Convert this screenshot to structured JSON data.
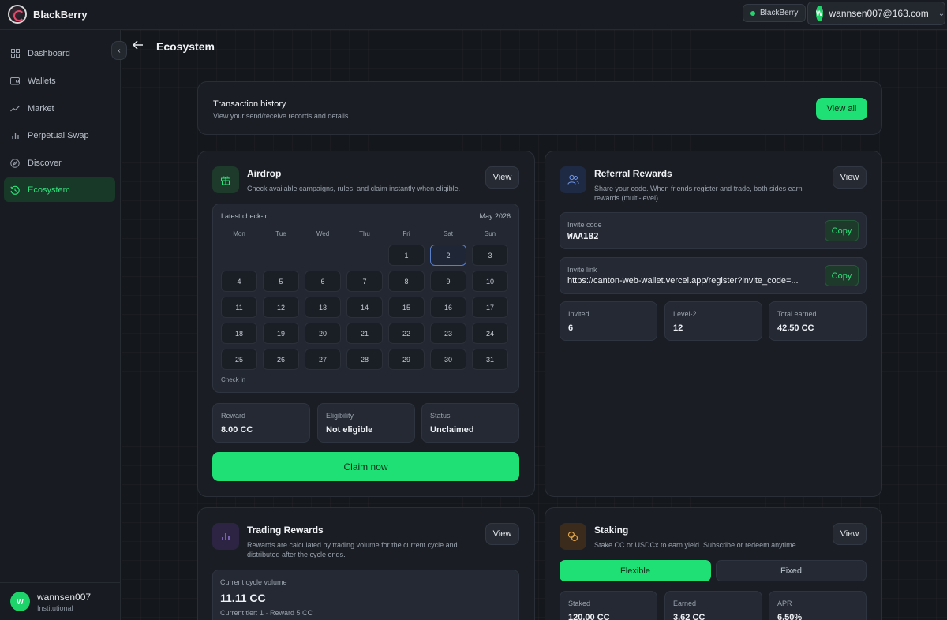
{
  "app": {
    "brand": "BlackBerry"
  },
  "header": {
    "network_label": "BlackBerry",
    "user_initial": "W",
    "user_email": "wannsen007@163.com"
  },
  "sidebar": {
    "items": [
      {
        "label": "Dashboard",
        "icon": "grid-icon"
      },
      {
        "label": "Wallets",
        "icon": "wallet-icon"
      },
      {
        "label": "Market",
        "icon": "trend-icon"
      },
      {
        "label": "Perpetual Swap",
        "icon": "bar-chart-icon"
      },
      {
        "label": "Discover",
        "icon": "compass-icon"
      },
      {
        "label": "Ecosystem",
        "icon": "history-icon",
        "active": true
      }
    ],
    "user": {
      "initial": "W",
      "name": "wannsen007",
      "role": "Institutional"
    }
  },
  "page": {
    "title": "Ecosystem"
  },
  "transactions": {
    "title": "Transaction history",
    "subtitle": "View your send/receive records and details",
    "button": "View all"
  },
  "airdrop": {
    "title": "Airdrop",
    "subtitle": "Check available campaigns, rules, and claim instantly when eligible.",
    "view_button": "View",
    "calendar": {
      "label": "Latest check-in",
      "month": "May 2026",
      "weekdays": [
        "Mon",
        "Tue",
        "Wed",
        "Thu",
        "Fri",
        "Sat",
        "Sun"
      ],
      "first_weekday_index": 4,
      "days_in_month": 31,
      "highlighted_day": 2,
      "footer": "Check in"
    },
    "reward": {
      "label": "Reward",
      "value": "8.00 CC"
    },
    "eligibility": {
      "label": "Eligibility",
      "value": "Not eligible"
    },
    "status": {
      "label": "Status",
      "value": "Unclaimed"
    },
    "claim_button": "Claim now"
  },
  "referral": {
    "title": "Referral Rewards",
    "subtitle": "Share your code. When friends register and trade, both sides earn rewards (multi-level).",
    "view_button": "View",
    "invite_code": {
      "label": "Invite code",
      "value": "WAA1B2",
      "button": "Copy"
    },
    "invite_link": {
      "label": "Invite link",
      "value": "https://canton-web-wallet.vercel.app/register?invite_code=...",
      "button": "Copy"
    },
    "invited": {
      "label": "Invited",
      "value": "6"
    },
    "level2": {
      "label": "Level-2",
      "value": "12"
    },
    "total_earned": {
      "label": "Total earned",
      "value": "42.50 CC"
    }
  },
  "trading": {
    "title": "Trading Rewards",
    "subtitle": "Rewards are calculated by trading volume for the current cycle and distributed after the cycle ends.",
    "view_button": "View",
    "cycle_label": "Current cycle volume",
    "cycle_value": "11.11 CC",
    "tier": "Current tier: 1 · Reward 5 CC"
  },
  "staking": {
    "title": "Staking",
    "subtitle": "Stake CC or USDCx to earn yield. Subscribe or redeem anytime.",
    "view_button": "View",
    "tabs": [
      "Flexible",
      "Fixed"
    ],
    "staked": {
      "label": "Staked",
      "value": "120.00 CC"
    },
    "earned": {
      "label": "Earned",
      "value": "3.62 CC"
    },
    "apr": {
      "label": "APR",
      "value": "6.50%"
    }
  },
  "colors": {
    "accent": "#1fe074",
    "active_nav": "#2ee37b",
    "background": "#14171c",
    "card": "#1a1e24"
  }
}
